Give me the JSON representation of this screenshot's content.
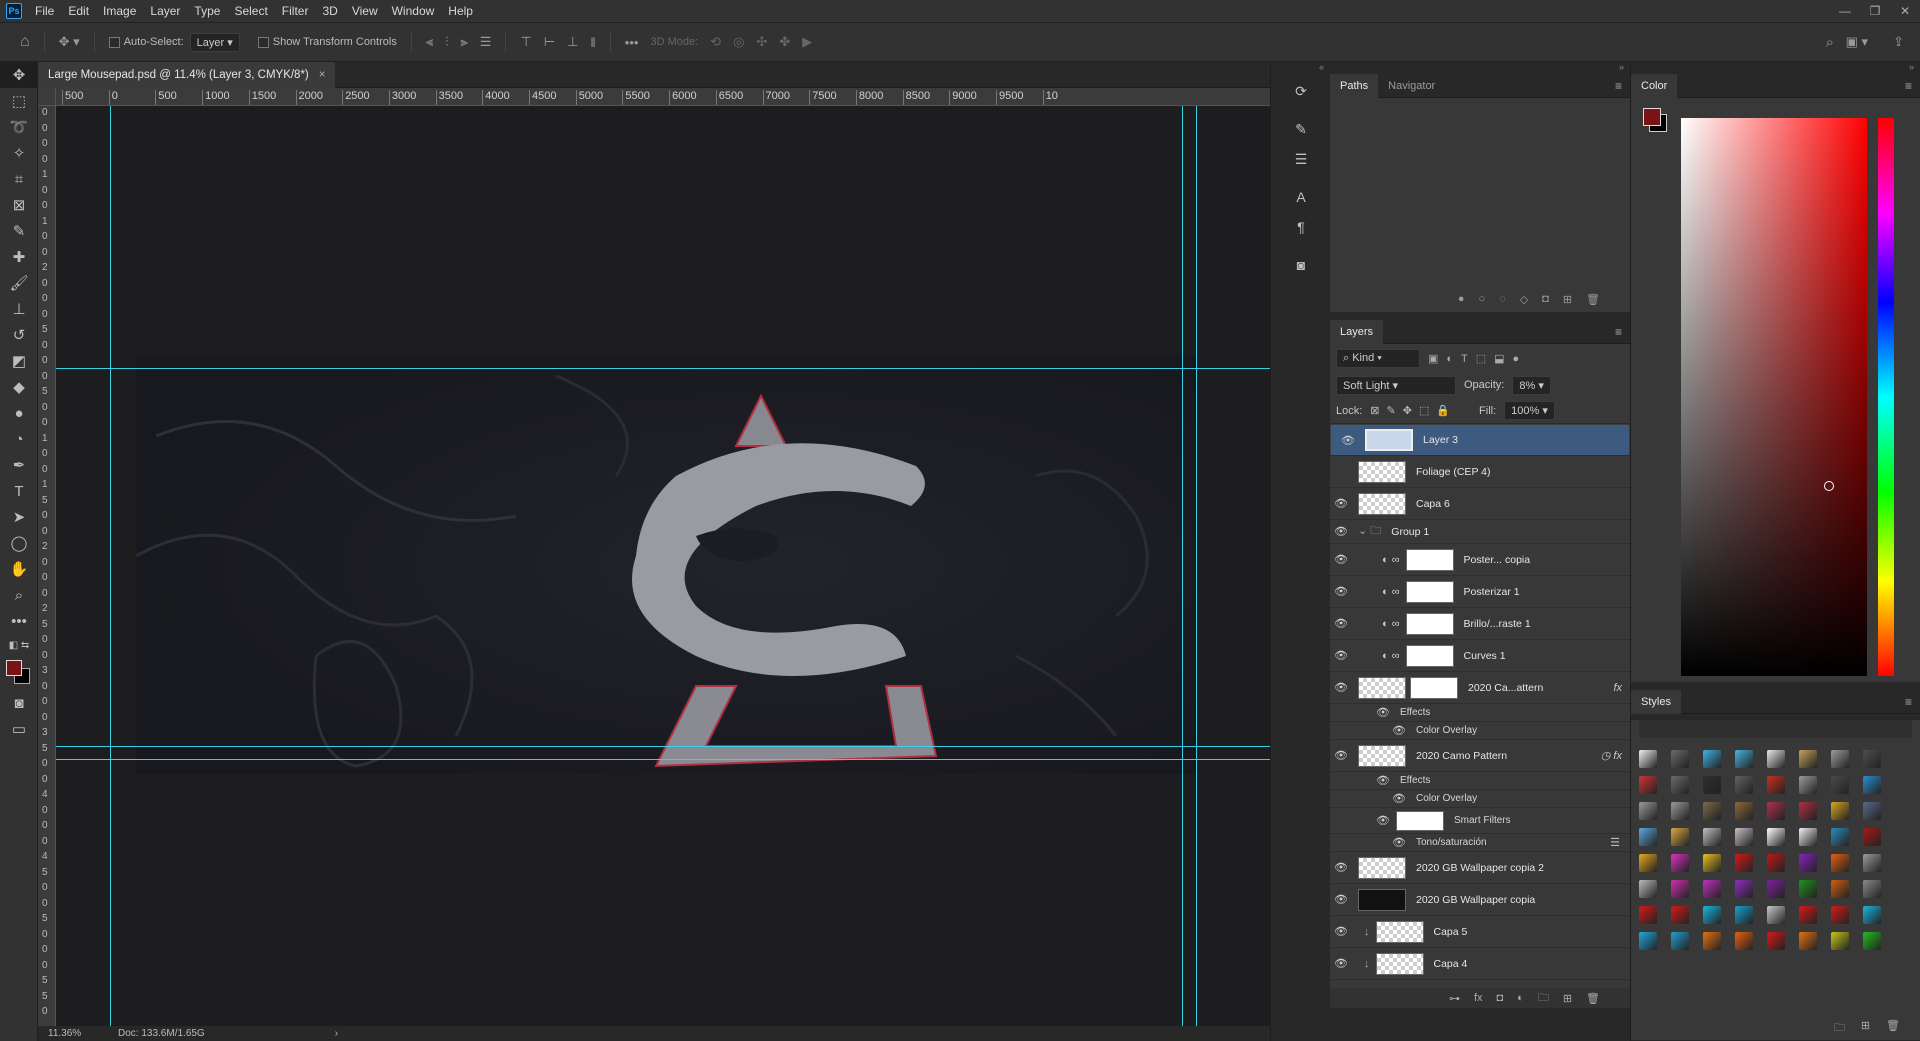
{
  "menubar": {
    "logo": "Ps",
    "items": [
      "File",
      "Edit",
      "Image",
      "Layer",
      "Type",
      "Select",
      "Filter",
      "3D",
      "View",
      "Window",
      "Help"
    ],
    "window_controls": [
      "—",
      "❐",
      "✕"
    ]
  },
  "options": {
    "auto_select_label": "Auto-Select:",
    "auto_select_value": "Layer",
    "show_transform_label": "Show Transform Controls",
    "mode_3d_label": "3D Mode:"
  },
  "document": {
    "tab_title": "Large Mousepad.psd @ 11.4% (Layer 3, CMYK/8*)",
    "close": "×"
  },
  "ruler_h_labels": [
    "500",
    "0",
    "500",
    "1000",
    "1500",
    "2000",
    "2500",
    "3000",
    "3500",
    "4000",
    "4500",
    "5000",
    "5500",
    "6000",
    "6500",
    "7000",
    "7500",
    "8000",
    "8500",
    "9000",
    "9500",
    "10"
  ],
  "ruler_v_labels": [
    "0",
    "0",
    "0",
    "0",
    "1",
    "0",
    "0",
    "1",
    "0",
    "0",
    "2",
    "0",
    "0",
    "0",
    "5",
    "0",
    "0",
    "0",
    "5",
    "0",
    "0",
    "1",
    "0",
    "0",
    "1",
    "5",
    "0",
    "0",
    "2",
    "0",
    "0",
    "0",
    "2",
    "5",
    "0",
    "0",
    "3",
    "0",
    "0",
    "0",
    "3",
    "5",
    "0",
    "0",
    "4",
    "0",
    "0",
    "0",
    "4",
    "5",
    "0",
    "0",
    "5",
    "0",
    "0",
    "0",
    "5",
    "5",
    "0"
  ],
  "status": {
    "zoom": "11.36%",
    "doc": "Doc: 133.6M/1.65G",
    "arrow": "›"
  },
  "paths_panel": {
    "tabs": [
      "Paths",
      "Navigator"
    ]
  },
  "layers_panel": {
    "tab": "Layers",
    "filter_kind": "Kind",
    "blend_mode": "Soft Light",
    "opacity_label": "Opacity:",
    "opacity_value": "8%",
    "lock_label": "Lock:",
    "fill_label": "Fill:",
    "fill_value": "100%",
    "layers": [
      {
        "name": "Layer 3",
        "visible": true,
        "selected": true
      },
      {
        "name": "Foliage (CEP 4)",
        "visible": false
      },
      {
        "name": "Capa 6",
        "visible": true
      },
      {
        "name": "Group 1",
        "visible": true,
        "group": true
      },
      {
        "name": "Poster... copia",
        "visible": true,
        "adjust": true
      },
      {
        "name": "Posterizar 1",
        "visible": true,
        "adjust": true
      },
      {
        "name": "Brillo/...raste 1",
        "visible": true,
        "adjust": true
      },
      {
        "name": "Curves 1",
        "visible": true,
        "adjust": true
      },
      {
        "name": "2020 Ca...attern",
        "visible": true,
        "fx": true
      },
      {
        "name": "Effects",
        "sub": true
      },
      {
        "name": "Color Overlay",
        "sub2": true
      },
      {
        "name": "2020 Camo Pattern",
        "visible": true,
        "fx": true
      },
      {
        "name": "Effects",
        "sub": true
      },
      {
        "name": "Color Overlay",
        "sub2": true
      },
      {
        "name": "Smart Filters",
        "smart": true
      },
      {
        "name": "Tono/saturación",
        "sub2": true
      },
      {
        "name": "2020 GB Wallpaper copia 2",
        "visible": true
      },
      {
        "name": "2020 GB Wallpaper copia",
        "visible": true
      },
      {
        "name": "Capa 5",
        "visible": true,
        "clip": true
      },
      {
        "name": "Capa 4",
        "visible": true,
        "clip": true
      }
    ]
  },
  "color_panel": {
    "tab": "Color",
    "foreground": "#7a1414",
    "background": "#000000"
  },
  "styles_panel": {
    "tab": "Styles",
    "swatches": [
      [
        "#f0f0f0",
        "#6b6b6b",
        "#3fb2e8",
        "#45b6e0",
        "#e8e8e8",
        "#c4a45a",
        "#9c9c9c",
        "#4f4f4f"
      ],
      [
        "#d13535",
        "#6b6b6b",
        "#2e2e2e",
        "#626262",
        "#c93020",
        "#9b9b9b",
        "#4b4b4b",
        "#2a8fd1"
      ],
      [
        "#9a9a9a",
        "#9a9a9a",
        "#7b6a48",
        "#8b6a3b",
        "#b03050",
        "#b03040",
        "#d8a820",
        "#5a6a8a"
      ],
      [
        "#5aa8e0",
        "#d9a840",
        "#bfbfbf",
        "#c8c0c8",
        "#ffffff",
        "#f0f0f0",
        "#2b8cc0",
        "#a81818"
      ],
      [
        "#e8a820",
        "#e030c0",
        "#e8c020",
        "#d81818",
        "#c01818",
        "#8a20c0",
        "#e86010",
        "#9a9a9a"
      ],
      [
        "#bcbcbc",
        "#d030b0",
        "#c030c0",
        "#9030c0",
        "#8020a0",
        "#209020",
        "#d06010",
        "#8a8a8a"
      ],
      [
        "#d81818",
        "#d81818",
        "#18b8e0",
        "#18a0d0",
        "#c8c8c8",
        "#d81818",
        "#d81818",
        "#18b8e0"
      ],
      [
        "#20a8e0",
        "#20a0d0",
        "#e87010",
        "#e86010",
        "#d81818",
        "#e87010",
        "#c8c818",
        "#20c020"
      ]
    ]
  }
}
